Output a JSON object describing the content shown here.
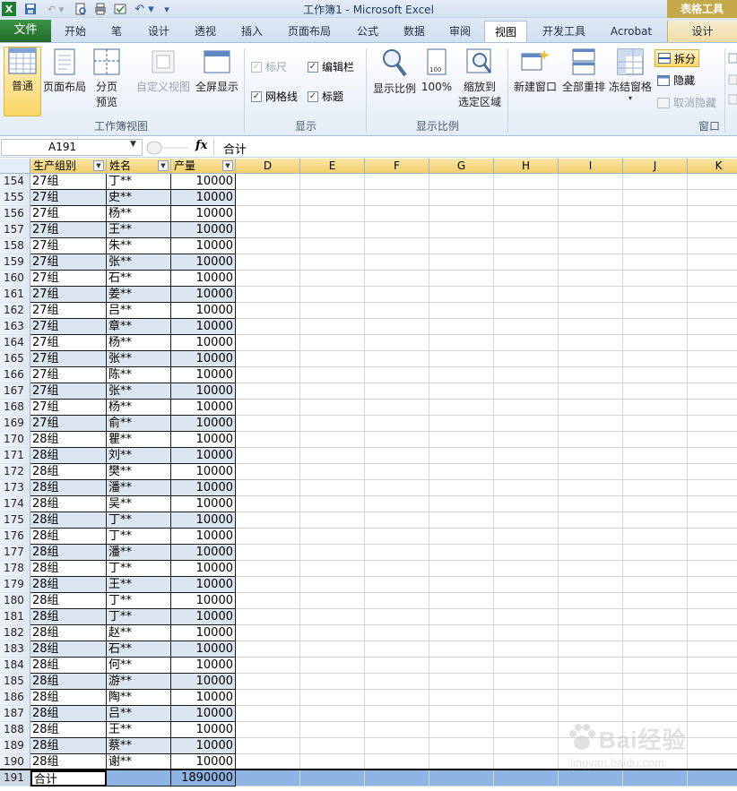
{
  "window": {
    "title": "工作簿1 - Microsoft Excel",
    "context_tab_group": "表格工具"
  },
  "tabs": [
    {
      "label": "文件"
    },
    {
      "label": "开始"
    },
    {
      "label": "笔"
    },
    {
      "label": "设计"
    },
    {
      "label": "透视"
    },
    {
      "label": "插入"
    },
    {
      "label": "页面布局"
    },
    {
      "label": "公式"
    },
    {
      "label": "数据"
    },
    {
      "label": "审阅"
    },
    {
      "label": "视图"
    },
    {
      "label": "开发工具"
    },
    {
      "label": "Acrobat"
    },
    {
      "label": "设计"
    }
  ],
  "ribbon": {
    "workbook_views": {
      "label": "工作簿视图",
      "normal": "普通",
      "page_layout": "页面布局",
      "page_break_1": "分页",
      "page_break_2": "预览",
      "custom_views": "自定义视图",
      "full_screen": "全屏显示"
    },
    "show": {
      "label": "显示",
      "ruler": "标尺",
      "formula_bar": "编辑栏",
      "gridlines": "网格线",
      "headings": "标题",
      "ruler_checked": "✓",
      "formula_bar_checked": "✓",
      "gridlines_checked": "✓",
      "headings_checked": "✓"
    },
    "zoom": {
      "label": "显示比例",
      "zoom": "显示比例",
      "hundred": "100%",
      "zoom_to_sel_1": "缩放到",
      "zoom_to_sel_2": "选定区域"
    },
    "window": {
      "label": "窗口",
      "new_window": "新建窗口",
      "arrange_all": "全部重排",
      "freeze_panes": "冻结窗格",
      "split": "拆分",
      "hide": "隐藏",
      "unhide": "取消隐藏"
    }
  },
  "formula_bar": {
    "name_box": "A191",
    "fx": "fx",
    "value": "合计"
  },
  "columns": [
    {
      "letter": "生产组别",
      "filter": true
    },
    {
      "letter": "姓名",
      "filter": true
    },
    {
      "letter": "产量",
      "filter": true
    },
    {
      "letter": "D"
    },
    {
      "letter": "E"
    },
    {
      "letter": "F"
    },
    {
      "letter": "G"
    },
    {
      "letter": "H"
    },
    {
      "letter": "I"
    },
    {
      "letter": "J"
    },
    {
      "letter": "K"
    }
  ],
  "rows": [
    {
      "n": "154",
      "group": "27组",
      "name": "丁**",
      "qty": "10000"
    },
    {
      "n": "155",
      "group": "27组",
      "name": "史**",
      "qty": "10000"
    },
    {
      "n": "156",
      "group": "27组",
      "name": "杨**",
      "qty": "10000"
    },
    {
      "n": "157",
      "group": "27组",
      "name": "王**",
      "qty": "10000"
    },
    {
      "n": "158",
      "group": "27组",
      "name": "朱**",
      "qty": "10000"
    },
    {
      "n": "159",
      "group": "27组",
      "name": "张**",
      "qty": "10000"
    },
    {
      "n": "160",
      "group": "27组",
      "name": "石**",
      "qty": "10000"
    },
    {
      "n": "161",
      "group": "27组",
      "name": "姜**",
      "qty": "10000"
    },
    {
      "n": "162",
      "group": "27组",
      "name": "吕**",
      "qty": "10000"
    },
    {
      "n": "163",
      "group": "27组",
      "name": "章**",
      "qty": "10000"
    },
    {
      "n": "164",
      "group": "27组",
      "name": "杨**",
      "qty": "10000"
    },
    {
      "n": "165",
      "group": "27组",
      "name": "张**",
      "qty": "10000"
    },
    {
      "n": "166",
      "group": "27组",
      "name": "陈**",
      "qty": "10000"
    },
    {
      "n": "167",
      "group": "27组",
      "name": "张**",
      "qty": "10000"
    },
    {
      "n": "168",
      "group": "27组",
      "name": "杨**",
      "qty": "10000"
    },
    {
      "n": "169",
      "group": "27组",
      "name": "俞**",
      "qty": "10000"
    },
    {
      "n": "170",
      "group": "28组",
      "name": "瞿**",
      "qty": "10000"
    },
    {
      "n": "171",
      "group": "28组",
      "name": "刘**",
      "qty": "10000"
    },
    {
      "n": "172",
      "group": "28组",
      "name": "樊**",
      "qty": "10000"
    },
    {
      "n": "173",
      "group": "28组",
      "name": "潘**",
      "qty": "10000"
    },
    {
      "n": "174",
      "group": "28组",
      "name": "吴**",
      "qty": "10000"
    },
    {
      "n": "175",
      "group": "28组",
      "name": "丁**",
      "qty": "10000"
    },
    {
      "n": "176",
      "group": "28组",
      "name": "丁**",
      "qty": "10000"
    },
    {
      "n": "177",
      "group": "28组",
      "name": "潘**",
      "qty": "10000"
    },
    {
      "n": "178",
      "group": "28组",
      "name": "丁**",
      "qty": "10000"
    },
    {
      "n": "179",
      "group": "28组",
      "name": "王**",
      "qty": "10000"
    },
    {
      "n": "180",
      "group": "28组",
      "name": "丁**",
      "qty": "10000"
    },
    {
      "n": "181",
      "group": "28组",
      "name": "丁**",
      "qty": "10000"
    },
    {
      "n": "182",
      "group": "28组",
      "name": "赵**",
      "qty": "10000"
    },
    {
      "n": "183",
      "group": "28组",
      "name": "石**",
      "qty": "10000"
    },
    {
      "n": "184",
      "group": "28组",
      "name": "何**",
      "qty": "10000"
    },
    {
      "n": "185",
      "group": "28组",
      "name": "游**",
      "qty": "10000"
    },
    {
      "n": "186",
      "group": "28组",
      "name": "陶**",
      "qty": "10000"
    },
    {
      "n": "187",
      "group": "28组",
      "name": "吕**",
      "qty": "10000"
    },
    {
      "n": "188",
      "group": "28组",
      "name": "王**",
      "qty": "10000"
    },
    {
      "n": "189",
      "group": "28组",
      "name": "蔡**",
      "qty": "10000"
    },
    {
      "n": "190",
      "group": "28组",
      "name": "谢**",
      "qty": "10000"
    }
  ],
  "total_row": {
    "n": "191",
    "group": "合计",
    "name": "",
    "qty": "1890000"
  },
  "watermark": {
    "text": "Bai经验",
    "sub": "jingyan.baidu.com"
  }
}
